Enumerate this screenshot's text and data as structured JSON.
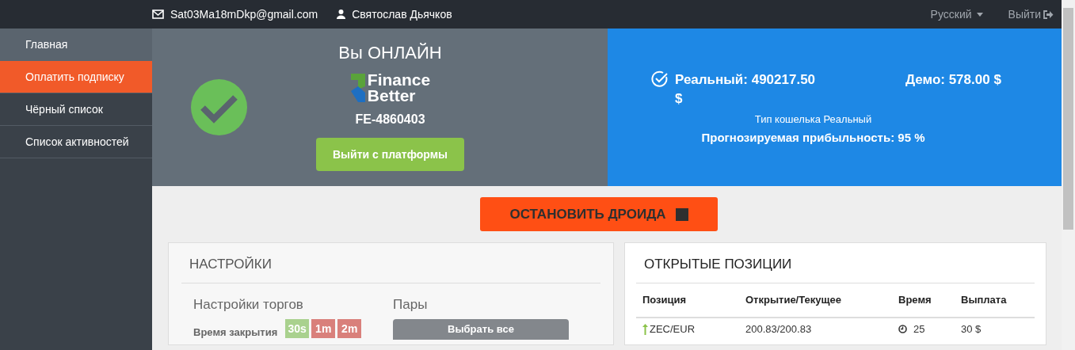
{
  "topbar": {
    "email": "Sat03Ma18mDkp@gmail.com",
    "user": "Святослав Дьячков",
    "language": "Русский",
    "logout": "Выйти"
  },
  "sidebar": {
    "items": [
      {
        "label": "Главная",
        "kind": "home",
        "selected": false
      },
      {
        "label": "Оплатить подписку",
        "kind": "link",
        "selected": true
      },
      {
        "label": "Чёрный список",
        "kind": "link",
        "selected": false
      },
      {
        "label": "Список активностей",
        "kind": "link",
        "selected": false
      }
    ]
  },
  "status": {
    "title": "Вы ОНЛАЙН",
    "logo": [
      "Finance",
      "Better"
    ],
    "account_id": "FE-4860403",
    "exit_button": "Выйти с платформы"
  },
  "balance": {
    "real": "Реальный: 490217.50 $",
    "demo": "Демо: 578.00 $",
    "wallet_type": "Тип кошелька Реальный",
    "profitability": "Прогнозируемая прибыльность: 95 %"
  },
  "stop_button": "ОСТАНОВИТЬ ДРОИДА",
  "settings": {
    "title": "НАСТРОЙКИ",
    "trade_title": "Настройки торгов",
    "close_time_label": "Время закрытия",
    "close_times": [
      {
        "label": "30s",
        "selected": true
      },
      {
        "label": "1m",
        "selected": false
      },
      {
        "label": "2m",
        "selected": false
      }
    ],
    "pairs_title": "Пары",
    "select_all": "Выбрать все"
  },
  "positions": {
    "title": "ОТКРЫТЫЕ ПОЗИЦИИ",
    "columns": [
      "Позиция",
      "Открытие/Текущее",
      "Время",
      "Выплата"
    ],
    "rows": [
      {
        "kind": "up",
        "pair": "ZEC/EUR",
        "prices": "200.83/200.83",
        "time": "25",
        "payout": "30 $"
      }
    ]
  }
}
